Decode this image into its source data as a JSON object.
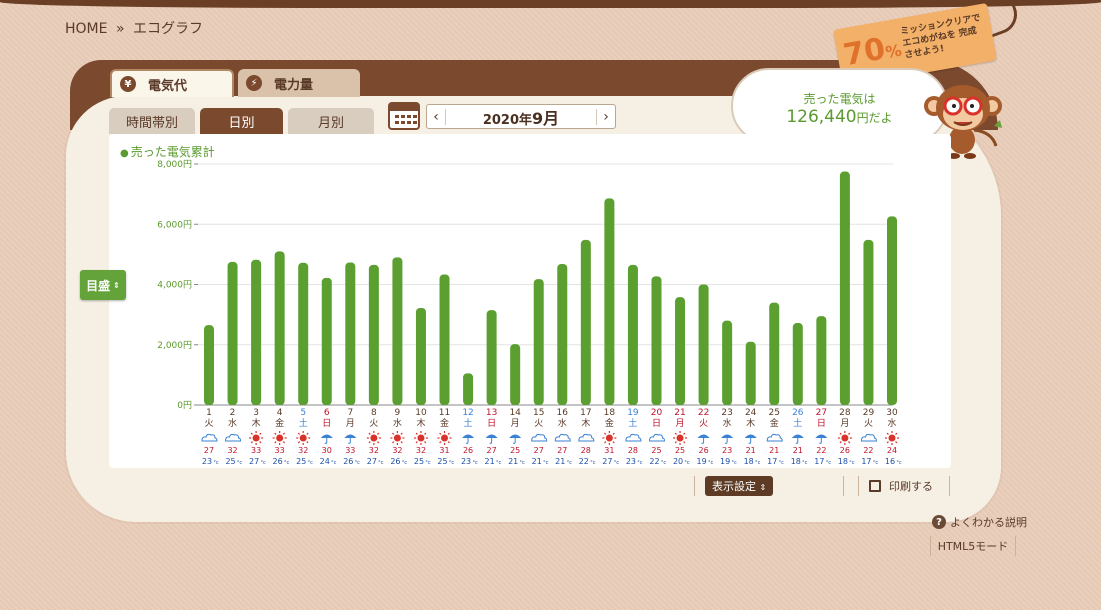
{
  "breadcrumb": {
    "home": "HOME",
    "sep": "»",
    "current": "エコグラフ"
  },
  "tabs_main": [
    {
      "label": "電気代",
      "icon": "yen-icon",
      "glyph": "¥"
    },
    {
      "label": "電力量",
      "icon": "bolt-icon",
      "glyph": "⚡"
    }
  ],
  "tabs_sub": [
    "時間帯別",
    "日別",
    "月別"
  ],
  "month_nav": {
    "year": "2020年",
    "month": "9月",
    "prev": "‹",
    "next": "›"
  },
  "meter_button": "目盛",
  "bubble": {
    "line1": "売った電気は",
    "amount": "126,440",
    "suffix": "円だよ"
  },
  "mission_tag": {
    "percent": "70",
    "percent_sign": "%",
    "text": "ミッションクリアで エコめがねを 完成させよう!"
  },
  "legend": "売った電気累計",
  "buttons": {
    "display_settings": "表示設定",
    "print": "印刷する",
    "help": "よくわかる説明",
    "html5": "HTML5モード"
  },
  "colors": {
    "bar": "#5a9f2f",
    "weekday": "#5a3a28",
    "saturday": "#3b82d6",
    "sunday_holiday": "#c0122a",
    "high_temp": "#c0122a",
    "low_temp": "#1d4fa8"
  },
  "chart_data": {
    "type": "bar",
    "ylim": [
      0,
      8000
    ],
    "yticks": [
      "0円",
      "2,000円",
      "4,000円",
      "6,000円",
      "8,000円"
    ],
    "ytick_values": [
      0,
      2000,
      4000,
      6000,
      8000
    ],
    "categories": [
      "1",
      "2",
      "3",
      "4",
      "5",
      "6",
      "7",
      "8",
      "9",
      "10",
      "11",
      "12",
      "13",
      "14",
      "15",
      "16",
      "17",
      "18",
      "19",
      "20",
      "21",
      "22",
      "23",
      "24",
      "25",
      "26",
      "27",
      "28",
      "29",
      "30"
    ],
    "weekdays": [
      "火",
      "水",
      "木",
      "金",
      "土",
      "日",
      "月",
      "火",
      "水",
      "木",
      "金",
      "土",
      "日",
      "月",
      "火",
      "水",
      "木",
      "金",
      "土",
      "日",
      "月",
      "火",
      "水",
      "木",
      "金",
      "土",
      "日",
      "月",
      "火",
      "水"
    ],
    "day_types": [
      "w",
      "w",
      "w",
      "w",
      "sat",
      "sun",
      "w",
      "w",
      "w",
      "w",
      "w",
      "sat",
      "sun",
      "w",
      "w",
      "w",
      "w",
      "w",
      "sat",
      "sun",
      "hol",
      "hol",
      "w",
      "w",
      "w",
      "sat",
      "sun",
      "w",
      "w",
      "w"
    ],
    "values": [
      2650,
      4750,
      4820,
      5100,
      4720,
      4220,
      4730,
      4650,
      4900,
      3220,
      4330,
      1050,
      3150,
      2020,
      4180,
      4680,
      5480,
      6860,
      4650,
      4270,
      3580,
      4000,
      2800,
      2100,
      3400,
      2720,
      2950,
      7750,
      5480,
      6260
    ],
    "weather": [
      "cloud",
      "cloud",
      "sun",
      "sun",
      "sun",
      "umbrella",
      "umbrella",
      "sun",
      "sun",
      "sun",
      "sun",
      "umbrella",
      "umbrella",
      "umbrella",
      "cloud",
      "cloud",
      "cloud",
      "sun",
      "cloud",
      "cloud",
      "sun",
      "umbrella",
      "umbrella",
      "umbrella",
      "cloud",
      "umbrella",
      "umbrella",
      "sun",
      "cloud",
      "sun"
    ],
    "high_temps": [
      "27",
      "32",
      "33",
      "33",
      "32",
      "30",
      "33",
      "32",
      "32",
      "32",
      "31",
      "26",
      "27",
      "25",
      "27",
      "27",
      "28",
      "31",
      "28",
      "25",
      "25",
      "26",
      "23",
      "21",
      "21",
      "21",
      "22",
      "26",
      "22",
      "24"
    ],
    "low_temps": [
      "23",
      "25",
      "27",
      "26",
      "25",
      "24",
      "26",
      "27",
      "26",
      "25",
      "25",
      "23",
      "21",
      "21",
      "21",
      "21",
      "22",
      "27",
      "23",
      "22",
      "20",
      "19",
      "19",
      "18",
      "17",
      "18",
      "17",
      "18",
      "17",
      "16"
    ],
    "temp_unit": "°c"
  }
}
